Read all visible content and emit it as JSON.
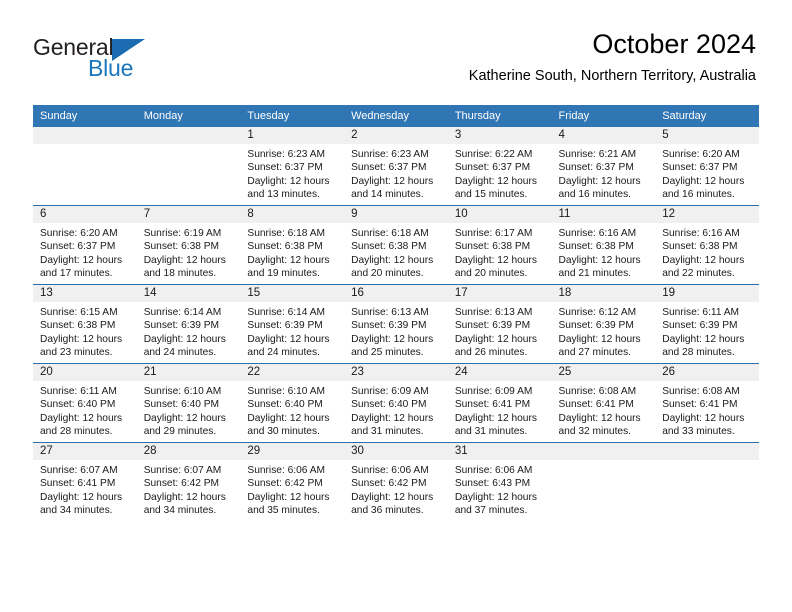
{
  "logo": {
    "word_one": "General",
    "word_two": "Blue",
    "triangle_color": "#1b6cb0",
    "blue_color": "#1b76bc"
  },
  "header": {
    "title": "October 2024",
    "subtitle": "Katherine South, Northern Territory, Australia"
  },
  "theme": {
    "header_blue": "#3075b4",
    "row_border_blue": "#2f6fad",
    "daynum_strip_gray": "#f0f0f0"
  },
  "weekday_headers": [
    "Sunday",
    "Monday",
    "Tuesday",
    "Wednesday",
    "Thursday",
    "Friday",
    "Saturday"
  ],
  "weeks": [
    [
      {
        "day": "",
        "sunrise": "",
        "sunset": "",
        "daylight_line1": "",
        "daylight_line2": "",
        "empty": true
      },
      {
        "day": "",
        "sunrise": "",
        "sunset": "",
        "daylight_line1": "",
        "daylight_line2": "",
        "empty": true
      },
      {
        "day": "1",
        "sunrise": "Sunrise: 6:23 AM",
        "sunset": "Sunset: 6:37 PM",
        "daylight_line1": "Daylight: 12 hours",
        "daylight_line2": "and 13 minutes."
      },
      {
        "day": "2",
        "sunrise": "Sunrise: 6:23 AM",
        "sunset": "Sunset: 6:37 PM",
        "daylight_line1": "Daylight: 12 hours",
        "daylight_line2": "and 14 minutes."
      },
      {
        "day": "3",
        "sunrise": "Sunrise: 6:22 AM",
        "sunset": "Sunset: 6:37 PM",
        "daylight_line1": "Daylight: 12 hours",
        "daylight_line2": "and 15 minutes."
      },
      {
        "day": "4",
        "sunrise": "Sunrise: 6:21 AM",
        "sunset": "Sunset: 6:37 PM",
        "daylight_line1": "Daylight: 12 hours",
        "daylight_line2": "and 16 minutes."
      },
      {
        "day": "5",
        "sunrise": "Sunrise: 6:20 AM",
        "sunset": "Sunset: 6:37 PM",
        "daylight_line1": "Daylight: 12 hours",
        "daylight_line2": "and 16 minutes."
      }
    ],
    [
      {
        "day": "6",
        "sunrise": "Sunrise: 6:20 AM",
        "sunset": "Sunset: 6:37 PM",
        "daylight_line1": "Daylight: 12 hours",
        "daylight_line2": "and 17 minutes."
      },
      {
        "day": "7",
        "sunrise": "Sunrise: 6:19 AM",
        "sunset": "Sunset: 6:38 PM",
        "daylight_line1": "Daylight: 12 hours",
        "daylight_line2": "and 18 minutes."
      },
      {
        "day": "8",
        "sunrise": "Sunrise: 6:18 AM",
        "sunset": "Sunset: 6:38 PM",
        "daylight_line1": "Daylight: 12 hours",
        "daylight_line2": "and 19 minutes."
      },
      {
        "day": "9",
        "sunrise": "Sunrise: 6:18 AM",
        "sunset": "Sunset: 6:38 PM",
        "daylight_line1": "Daylight: 12 hours",
        "daylight_line2": "and 20 minutes."
      },
      {
        "day": "10",
        "sunrise": "Sunrise: 6:17 AM",
        "sunset": "Sunset: 6:38 PM",
        "daylight_line1": "Daylight: 12 hours",
        "daylight_line2": "and 20 minutes."
      },
      {
        "day": "11",
        "sunrise": "Sunrise: 6:16 AM",
        "sunset": "Sunset: 6:38 PM",
        "daylight_line1": "Daylight: 12 hours",
        "daylight_line2": "and 21 minutes."
      },
      {
        "day": "12",
        "sunrise": "Sunrise: 6:16 AM",
        "sunset": "Sunset: 6:38 PM",
        "daylight_line1": "Daylight: 12 hours",
        "daylight_line2": "and 22 minutes."
      }
    ],
    [
      {
        "day": "13",
        "sunrise": "Sunrise: 6:15 AM",
        "sunset": "Sunset: 6:38 PM",
        "daylight_line1": "Daylight: 12 hours",
        "daylight_line2": "and 23 minutes."
      },
      {
        "day": "14",
        "sunrise": "Sunrise: 6:14 AM",
        "sunset": "Sunset: 6:39 PM",
        "daylight_line1": "Daylight: 12 hours",
        "daylight_line2": "and 24 minutes."
      },
      {
        "day": "15",
        "sunrise": "Sunrise: 6:14 AM",
        "sunset": "Sunset: 6:39 PM",
        "daylight_line1": "Daylight: 12 hours",
        "daylight_line2": "and 24 minutes."
      },
      {
        "day": "16",
        "sunrise": "Sunrise: 6:13 AM",
        "sunset": "Sunset: 6:39 PM",
        "daylight_line1": "Daylight: 12 hours",
        "daylight_line2": "and 25 minutes."
      },
      {
        "day": "17",
        "sunrise": "Sunrise: 6:13 AM",
        "sunset": "Sunset: 6:39 PM",
        "daylight_line1": "Daylight: 12 hours",
        "daylight_line2": "and 26 minutes."
      },
      {
        "day": "18",
        "sunrise": "Sunrise: 6:12 AM",
        "sunset": "Sunset: 6:39 PM",
        "daylight_line1": "Daylight: 12 hours",
        "daylight_line2": "and 27 minutes."
      },
      {
        "day": "19",
        "sunrise": "Sunrise: 6:11 AM",
        "sunset": "Sunset: 6:39 PM",
        "daylight_line1": "Daylight: 12 hours",
        "daylight_line2": "and 28 minutes."
      }
    ],
    [
      {
        "day": "20",
        "sunrise": "Sunrise: 6:11 AM",
        "sunset": "Sunset: 6:40 PM",
        "daylight_line1": "Daylight: 12 hours",
        "daylight_line2": "and 28 minutes."
      },
      {
        "day": "21",
        "sunrise": "Sunrise: 6:10 AM",
        "sunset": "Sunset: 6:40 PM",
        "daylight_line1": "Daylight: 12 hours",
        "daylight_line2": "and 29 minutes."
      },
      {
        "day": "22",
        "sunrise": "Sunrise: 6:10 AM",
        "sunset": "Sunset: 6:40 PM",
        "daylight_line1": "Daylight: 12 hours",
        "daylight_line2": "and 30 minutes."
      },
      {
        "day": "23",
        "sunrise": "Sunrise: 6:09 AM",
        "sunset": "Sunset: 6:40 PM",
        "daylight_line1": "Daylight: 12 hours",
        "daylight_line2": "and 31 minutes."
      },
      {
        "day": "24",
        "sunrise": "Sunrise: 6:09 AM",
        "sunset": "Sunset: 6:41 PM",
        "daylight_line1": "Daylight: 12 hours",
        "daylight_line2": "and 31 minutes."
      },
      {
        "day": "25",
        "sunrise": "Sunrise: 6:08 AM",
        "sunset": "Sunset: 6:41 PM",
        "daylight_line1": "Daylight: 12 hours",
        "daylight_line2": "and 32 minutes."
      },
      {
        "day": "26",
        "sunrise": "Sunrise: 6:08 AM",
        "sunset": "Sunset: 6:41 PM",
        "daylight_line1": "Daylight: 12 hours",
        "daylight_line2": "and 33 minutes."
      }
    ],
    [
      {
        "day": "27",
        "sunrise": "Sunrise: 6:07 AM",
        "sunset": "Sunset: 6:41 PM",
        "daylight_line1": "Daylight: 12 hours",
        "daylight_line2": "and 34 minutes."
      },
      {
        "day": "28",
        "sunrise": "Sunrise: 6:07 AM",
        "sunset": "Sunset: 6:42 PM",
        "daylight_line1": "Daylight: 12 hours",
        "daylight_line2": "and 34 minutes."
      },
      {
        "day": "29",
        "sunrise": "Sunrise: 6:06 AM",
        "sunset": "Sunset: 6:42 PM",
        "daylight_line1": "Daylight: 12 hours",
        "daylight_line2": "and 35 minutes."
      },
      {
        "day": "30",
        "sunrise": "Sunrise: 6:06 AM",
        "sunset": "Sunset: 6:42 PM",
        "daylight_line1": "Daylight: 12 hours",
        "daylight_line2": "and 36 minutes."
      },
      {
        "day": "31",
        "sunrise": "Sunrise: 6:06 AM",
        "sunset": "Sunset: 6:43 PM",
        "daylight_line1": "Daylight: 12 hours",
        "daylight_line2": "and 37 minutes."
      },
      {
        "day": "",
        "sunrise": "",
        "sunset": "",
        "daylight_line1": "",
        "daylight_line2": "",
        "empty": true
      },
      {
        "day": "",
        "sunrise": "",
        "sunset": "",
        "daylight_line1": "",
        "daylight_line2": "",
        "empty": true
      }
    ]
  ]
}
